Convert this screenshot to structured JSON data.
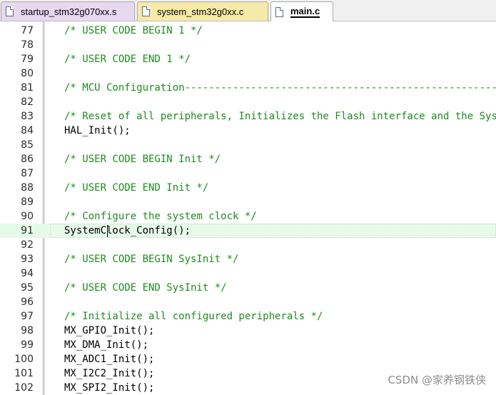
{
  "tabs": [
    {
      "label": "startup_stm32g070xx.s",
      "active": false,
      "color": "#e6d9f0"
    },
    {
      "label": "system_stm32g0xx.c",
      "active": false,
      "color": "#f5eaa8"
    },
    {
      "label": "main.c",
      "active": true,
      "color": "#ffffff"
    }
  ],
  "editor": {
    "current_line": "91",
    "comment_color": "#1e8c1e",
    "current_line_color": "#e6fae9",
    "lines": [
      {
        "num": "77",
        "text": "/* USER CODE BEGIN 1 */",
        "kind": "comment"
      },
      {
        "num": "78",
        "text": "",
        "kind": "code"
      },
      {
        "num": "79",
        "text": "/* USER CODE END 1 */",
        "kind": "comment"
      },
      {
        "num": "80",
        "text": "",
        "kind": "code"
      },
      {
        "num": "81",
        "text": "/* MCU Configuration---------------------------------------------------------",
        "kind": "comment"
      },
      {
        "num": "82",
        "text": "",
        "kind": "code"
      },
      {
        "num": "83",
        "text": "/* Reset of all peripherals, Initializes the Flash interface and the Systick",
        "kind": "comment"
      },
      {
        "num": "84",
        "text": "HAL_Init();",
        "kind": "code"
      },
      {
        "num": "85",
        "text": "",
        "kind": "code"
      },
      {
        "num": "86",
        "text": "/* USER CODE BEGIN Init */",
        "kind": "comment"
      },
      {
        "num": "87",
        "text": "",
        "kind": "code"
      },
      {
        "num": "88",
        "text": "/* USER CODE END Init */",
        "kind": "comment"
      },
      {
        "num": "89",
        "text": "",
        "kind": "code"
      },
      {
        "num": "90",
        "text": "/* Configure the system clock */",
        "kind": "comment"
      },
      {
        "num": "91",
        "text": "SystemClock_Config();",
        "kind": "code"
      },
      {
        "num": "92",
        "text": "",
        "kind": "code"
      },
      {
        "num": "93",
        "text": "/* USER CODE BEGIN SysInit */",
        "kind": "comment"
      },
      {
        "num": "94",
        "text": "",
        "kind": "code"
      },
      {
        "num": "95",
        "text": "/* USER CODE END SysInit */",
        "kind": "comment"
      },
      {
        "num": "96",
        "text": "",
        "kind": "code"
      },
      {
        "num": "97",
        "text": "/* Initialize all configured peripherals */",
        "kind": "comment"
      },
      {
        "num": "98",
        "text": "MX_GPIO_Init();",
        "kind": "code"
      },
      {
        "num": "99",
        "text": "MX_DMA_Init();",
        "kind": "code"
      },
      {
        "num": "100",
        "text": "MX_ADC1_Init();",
        "kind": "code"
      },
      {
        "num": "101",
        "text": "MX_I2C2_Init();",
        "kind": "code"
      },
      {
        "num": "102",
        "text": "MX_SPI2_Init();",
        "kind": "code"
      }
    ]
  },
  "watermark": "CSDN @家养钢铁侠"
}
